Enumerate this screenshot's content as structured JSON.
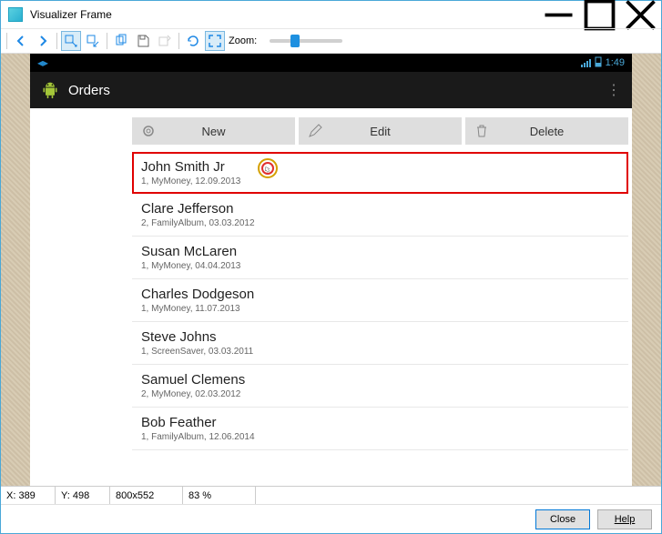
{
  "window": {
    "title": "Visualizer Frame"
  },
  "toolbar": {
    "zoom_label": "Zoom:"
  },
  "statusbar": {
    "time": "1:49",
    "battery": "🔋"
  },
  "appbar": {
    "title": "Orders"
  },
  "actions": {
    "new": "New",
    "edit": "Edit",
    "delete": "Delete"
  },
  "orders": [
    {
      "name": "John Smith Jr",
      "sub": "1, MyMoney, 12.09.2013",
      "selected": true
    },
    {
      "name": "Clare Jefferson",
      "sub": "2, FamilyAlbum, 03.03.2012"
    },
    {
      "name": "Susan McLaren",
      "sub": "1, MyMoney, 04.04.2013"
    },
    {
      "name": "Charles Dodgeson",
      "sub": "1, MyMoney, 11.07.2013"
    },
    {
      "name": "Steve Johns",
      "sub": "1, ScreenSaver, 03.03.2011"
    },
    {
      "name": "Samuel Clemens",
      "sub": "2, MyMoney, 02.03.2012"
    },
    {
      "name": "Bob Feather",
      "sub": "1, FamilyAlbum, 12.06.2014"
    }
  ],
  "status": {
    "x": "X: 389",
    "y": "Y: 498",
    "size": "800x552",
    "zoom": "83 %"
  },
  "buttons": {
    "close": "Close",
    "help": "Help"
  }
}
